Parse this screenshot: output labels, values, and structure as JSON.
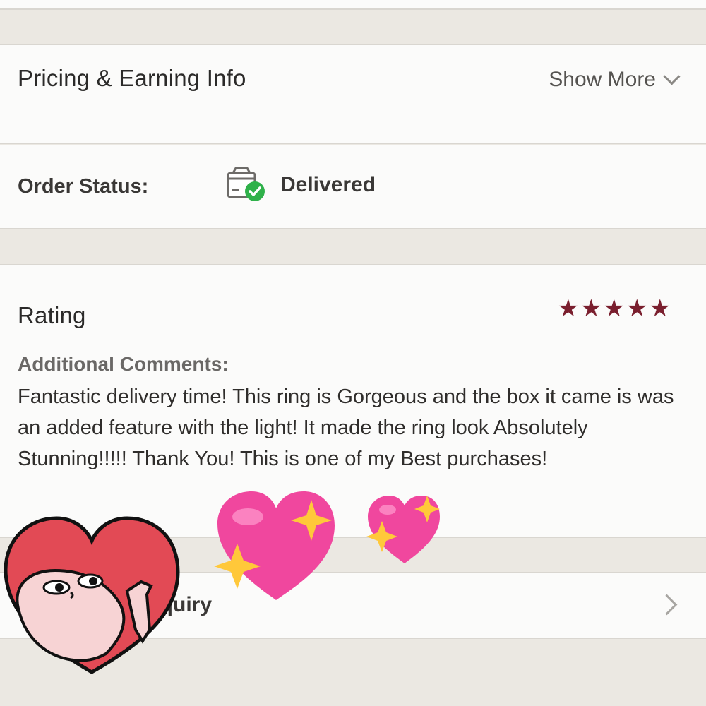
{
  "pricing": {
    "title": "Pricing & Earning Info",
    "show_more_label": "Show More"
  },
  "order_status": {
    "label": "Order Status:",
    "value": "Delivered",
    "icon": "box-check-icon",
    "status_color": "#2fb14a"
  },
  "rating": {
    "title": "Rating",
    "stars": 5,
    "max_stars": 5,
    "star_color": "#7a1f2e",
    "comments_label": "Additional Comments:",
    "comments_text": "Fantastic delivery time! This ring is Gorgeous and the box it came is was an added feature with the light! It made the ring look Absolutely Stunning!!!!! Thank You! This is one of my Best purchases!"
  },
  "order_inquiry": {
    "label": "der Inquiry"
  },
  "stickers": [
    "heart-face-sticker",
    "sparkling-heart-icon",
    "sparkling-heart-icon"
  ]
}
